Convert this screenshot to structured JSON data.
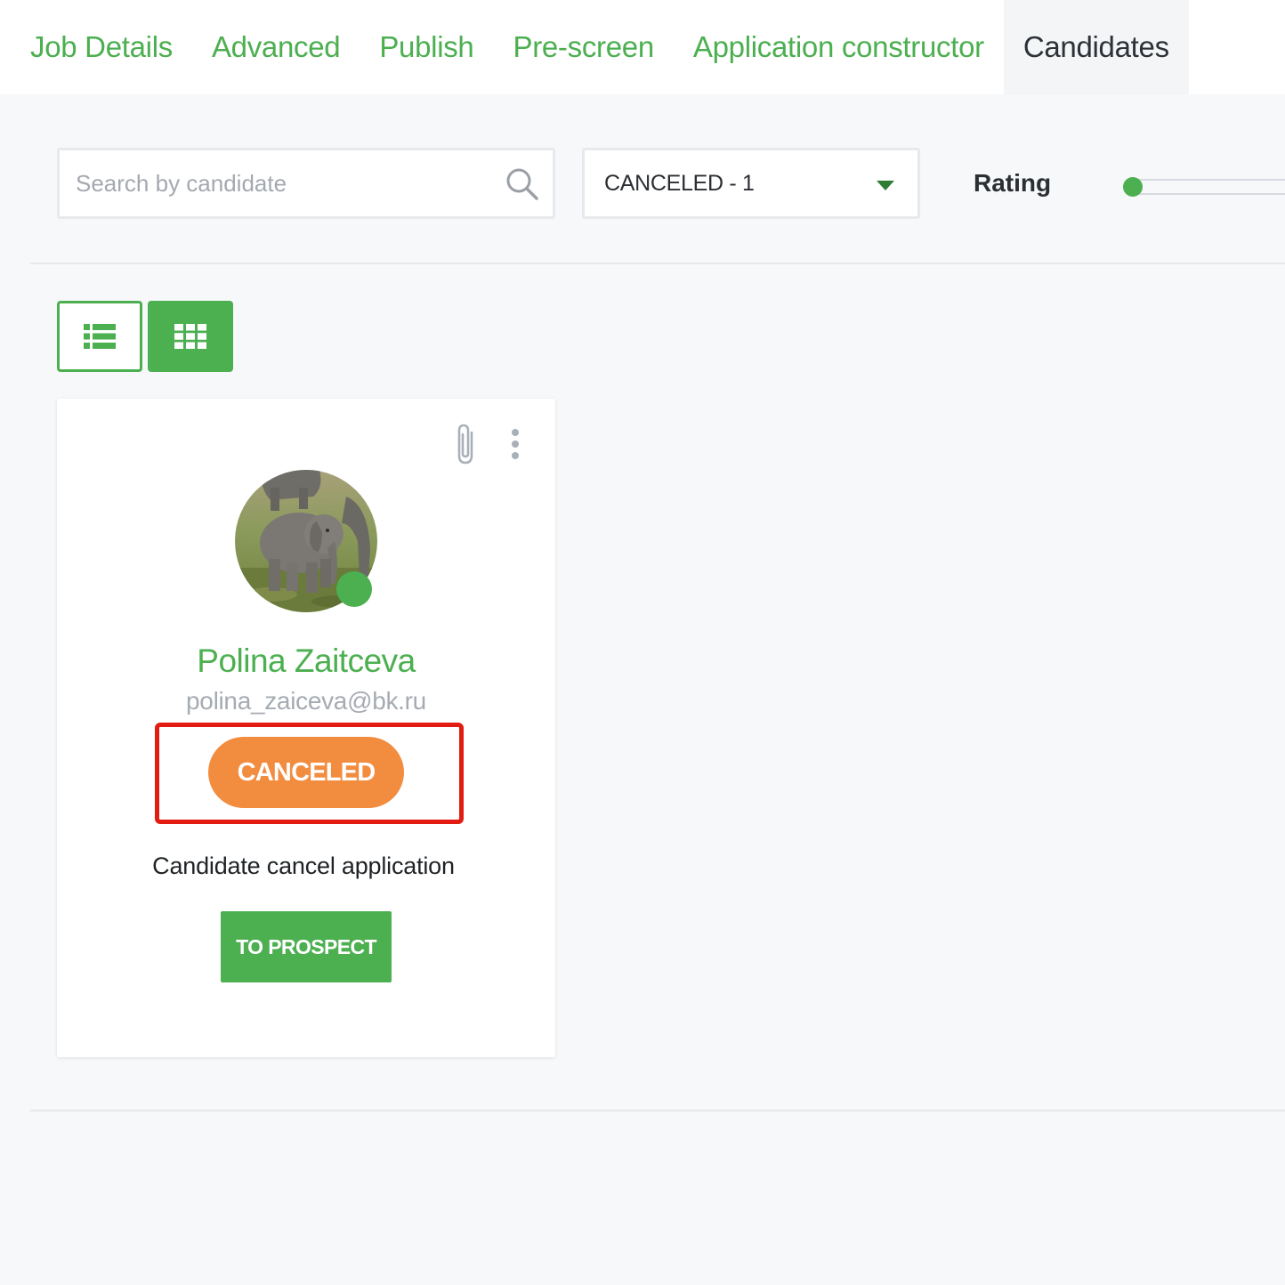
{
  "tabs": [
    {
      "label": "Job Details",
      "active": false
    },
    {
      "label": "Advanced",
      "active": false
    },
    {
      "label": "Publish",
      "active": false
    },
    {
      "label": "Pre-screen",
      "active": false
    },
    {
      "label": "Application constructor",
      "active": false
    },
    {
      "label": "Candidates",
      "active": true
    }
  ],
  "filters": {
    "search_placeholder": "Search by candidate",
    "search_value": "",
    "status_selected": "CANCELED - 1",
    "rating_label": "Rating",
    "rating_value": 0
  },
  "view_toggle": {
    "list_icon": "list-view-icon",
    "grid_icon": "grid-view-icon",
    "active": "grid"
  },
  "candidate": {
    "name": "Polina Zaitceva",
    "email": "polina_zaiceva@bk.ru",
    "status": "CANCELED",
    "reason": "Candidate cancel application",
    "action_label": "TO PROSPECT",
    "online": true,
    "avatar_subject": "elephant calf photo"
  },
  "colors": {
    "accent": "#4caf50",
    "status_canceled": "#f28c3f",
    "highlight": "#e21c12",
    "tab_active_text": "#2d3238"
  }
}
